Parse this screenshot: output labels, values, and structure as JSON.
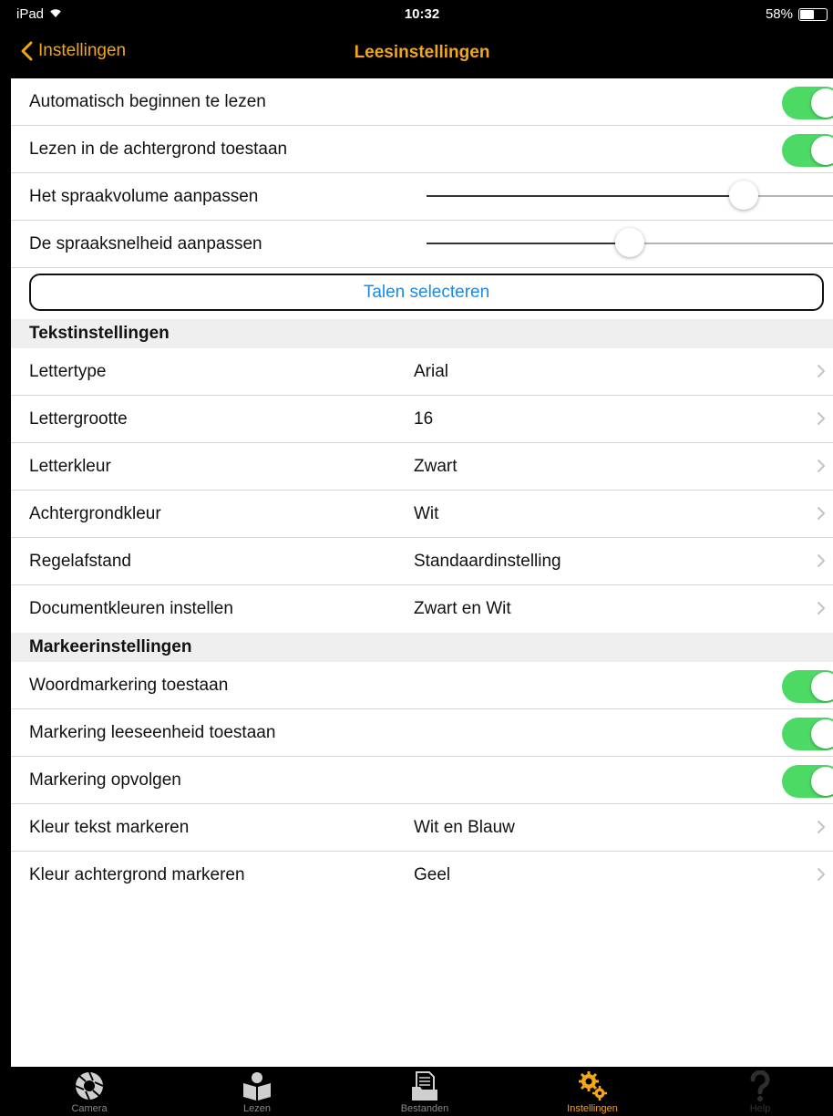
{
  "status_bar": {
    "device": "iPad",
    "time": "10:32",
    "battery": "58%",
    "battery_level": 0.58
  },
  "nav": {
    "back_label": "Instellingen",
    "title": "Leesinstellingen",
    "accent_color": "#f2a618"
  },
  "reading": {
    "auto_start": {
      "label": "Automatisch beginnen te lezen",
      "on": true
    },
    "background": {
      "label": "Lezen in de achtergrond toestaan",
      "on": true
    },
    "volume": {
      "label": "Het spraakvolume aanpassen",
      "value": 0.78
    },
    "speed": {
      "label": "De spraaksnelheid aanpassen",
      "value": 0.5
    },
    "languages_button": "Talen selecteren"
  },
  "text_settings": {
    "header": "Tekstinstellingen",
    "rows": [
      {
        "label": "Lettertype",
        "value": "Arial"
      },
      {
        "label": "Lettergrootte",
        "value": "16"
      },
      {
        "label": "Letterkleur",
        "value": "Zwart"
      },
      {
        "label": "Achtergrondkleur",
        "value": "Wit"
      },
      {
        "label": "Regelafstand",
        "value": "Standaardinstelling"
      },
      {
        "label": "Documentkleuren instellen",
        "value": "Zwart en Wit"
      }
    ]
  },
  "highlight_settings": {
    "header": "Markeerinstellingen",
    "toggles": [
      {
        "label": "Woordmarkering toestaan",
        "on": true
      },
      {
        "label": "Markering leeseenheid toestaan",
        "on": true
      },
      {
        "label": "Markering opvolgen",
        "on": true
      }
    ],
    "rows": [
      {
        "label": "Kleur tekst markeren",
        "value": "Wit en Blauw"
      },
      {
        "label": "Kleur achtergrond markeren",
        "value": "Geel"
      }
    ]
  },
  "tabs": [
    {
      "label": "Camera",
      "icon": "camera-aperture-icon",
      "active": false
    },
    {
      "label": "Lezen",
      "icon": "reader-book-icon",
      "active": false
    },
    {
      "label": "Bestanden",
      "icon": "files-folder-icon",
      "active": false
    },
    {
      "label": "Instellingen",
      "icon": "gears-icon",
      "active": true
    },
    {
      "label": "Help",
      "icon": "question-mark-icon",
      "active": false
    }
  ],
  "colors": {
    "toggle_on": "#4cd964",
    "link_blue": "#1e88e5",
    "tab_active": "#f2a618",
    "tab_inactive": "#8a8a8a"
  }
}
